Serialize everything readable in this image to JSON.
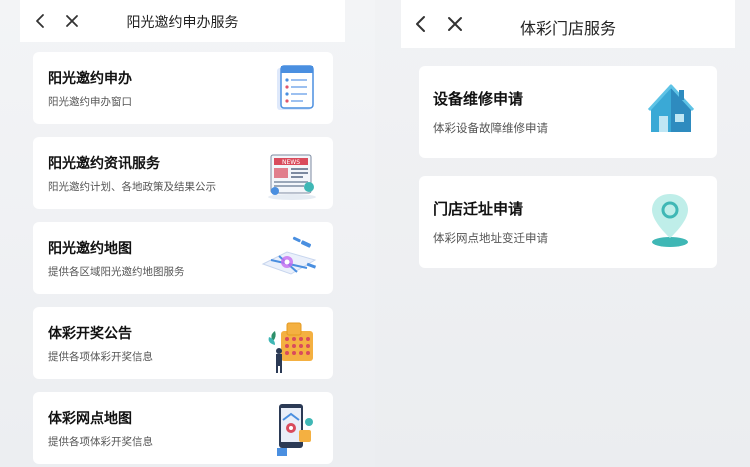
{
  "left_screen": {
    "title": "阳光邀约申办服务",
    "cards": [
      {
        "title": "阳光邀约申办",
        "subtitle": "阳光邀约申办窗口",
        "icon": "notepad-icon"
      },
      {
        "title": "阳光邀约资讯服务",
        "subtitle": "阳光邀约计划、各地政策及结果公示",
        "icon": "newspaper-icon"
      },
      {
        "title": "阳光邀约地图",
        "subtitle": "提供各区域阳光邀约地图服务",
        "icon": "map-icon"
      },
      {
        "title": "体彩开奖公告",
        "subtitle": "提供各项体彩开奖信息",
        "icon": "lottery-board-icon"
      },
      {
        "title": "体彩网点地图",
        "subtitle": "提供各项体彩开奖信息",
        "icon": "phone-map-icon"
      }
    ]
  },
  "right_screen": {
    "title": "体彩门店服务",
    "cards": [
      {
        "title": "设备维修申请",
        "subtitle": "体彩设备故障维修申请",
        "icon": "house-icon"
      },
      {
        "title": "门店迁址申请",
        "subtitle": "体彩网点地址变迁申请",
        "icon": "location-pin-icon"
      }
    ]
  },
  "colors": {
    "teal": "#3fb7b5",
    "blue": "#4a8fe0",
    "background": "#eef0f3"
  }
}
